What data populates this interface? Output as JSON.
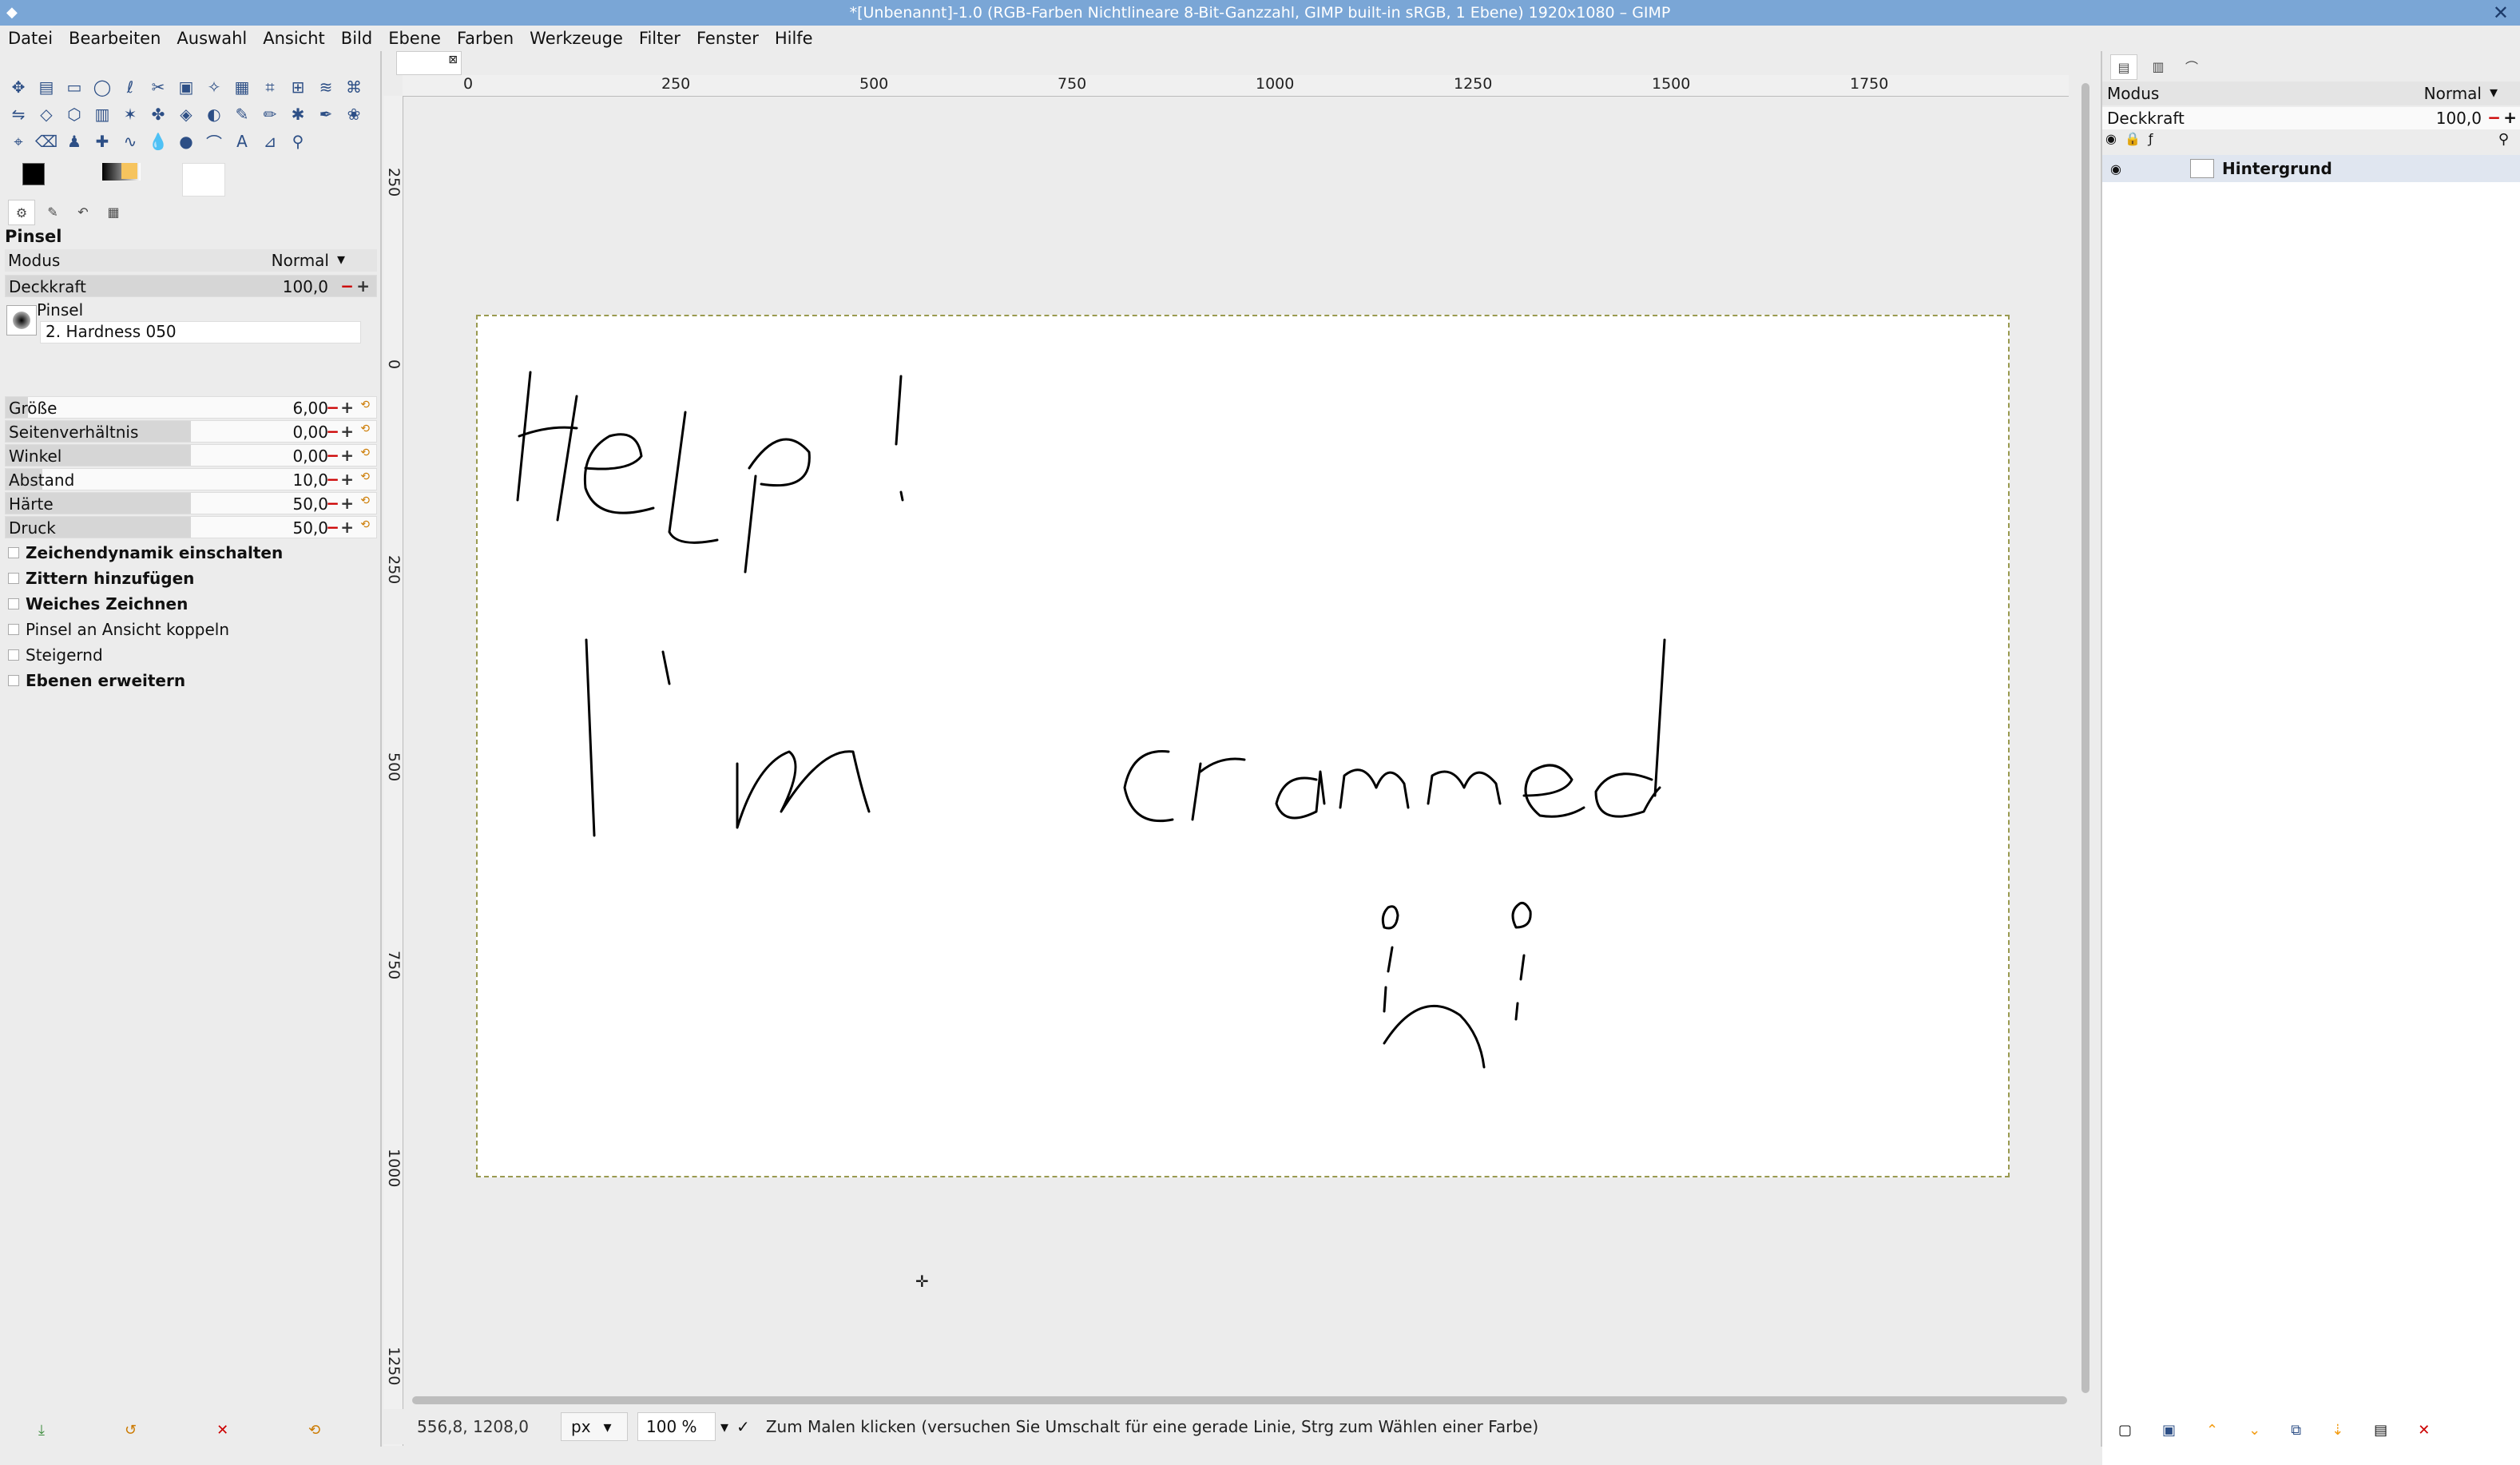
{
  "window": {
    "title": "*[Unbenannt]-1.0 (RGB-Farben Nichtlineare 8-Bit-Ganzzahl, GIMP built-in sRGB, 1 Ebene) 1920x1080 – GIMP"
  },
  "menubar": [
    "Datei",
    "Bearbeiten",
    "Auswahl",
    "Ansicht",
    "Bild",
    "Ebene",
    "Farben",
    "Werkzeuge",
    "Filter",
    "Fenster",
    "Hilfe"
  ],
  "tool_options": {
    "title": "Pinsel",
    "mode_label": "Modus",
    "mode_value": "Normal",
    "opacity_label": "Deckkraft",
    "opacity_value": "100,0",
    "brush_label": "Pinsel",
    "brush_name": "2. Hardness 050",
    "params": [
      {
        "label": "Größe",
        "value": "6,00",
        "fill": 0.06
      },
      {
        "label": "Seitenverhältnis",
        "value": "0,00",
        "fill": 0.5
      },
      {
        "label": "Winkel",
        "value": "0,00",
        "fill": 0.5
      },
      {
        "label": "Abstand",
        "value": "10,0",
        "fill": 0.1
      },
      {
        "label": "Härte",
        "value": "50,0",
        "fill": 0.5
      },
      {
        "label": "Druck",
        "value": "50,0",
        "fill": 0.5
      }
    ],
    "checks": [
      {
        "label": "Zeichendynamik einschalten",
        "bold": true
      },
      {
        "label": "Zittern hinzufügen",
        "bold": true
      },
      {
        "label": "Weiches Zeichnen",
        "bold": true
      },
      {
        "label": "Pinsel an Ansicht koppeln",
        "bold": false
      },
      {
        "label": "Steigernd",
        "bold": false
      },
      {
        "label": "Ebenen erweitern",
        "bold": true
      }
    ]
  },
  "ruler": {
    "h_ticks": [
      "0",
      "250",
      "500",
      "750",
      "1000",
      "1250",
      "1500",
      "1750"
    ],
    "v_ticks": [
      "250",
      "0",
      "250",
      "500",
      "750",
      "1000",
      "1250"
    ]
  },
  "canvas_text": {
    "line1": "Help!",
    "line2": "I'm crammed"
  },
  "statusbar": {
    "coords": "556,8, 1208,0",
    "unit": "px",
    "zoom": "100 %",
    "message": "Zum Malen klicken (versuchen Sie Umschalt für eine gerade Linie, Strg zum Wählen einer Farbe)"
  },
  "layers": {
    "mode_label": "Modus",
    "mode_value": "Normal",
    "opacity_label": "Deckkraft",
    "opacity_value": "100,0",
    "layer_name": "Hintergrund"
  },
  "colors": {
    "titlebar": "#7aa6d6",
    "panel": "#ececec",
    "foreground": "#000000",
    "background": "#ffffff"
  }
}
